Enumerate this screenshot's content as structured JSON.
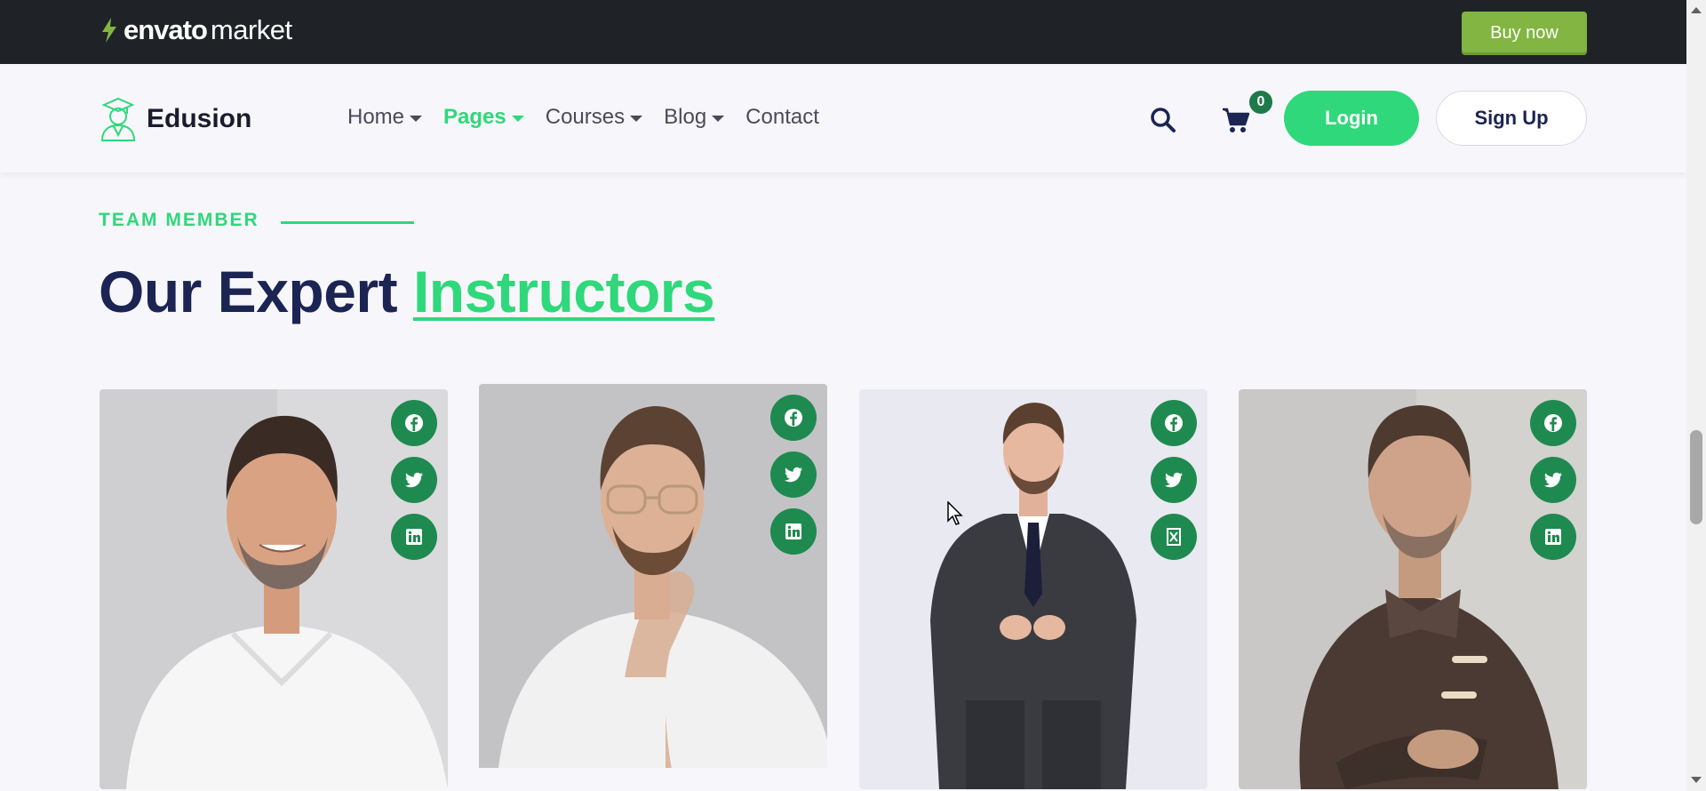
{
  "envato": {
    "logo_brand": "envato",
    "logo_product": "market",
    "buy_now_label": "Buy now",
    "brand_color": "#82b541"
  },
  "header": {
    "brand_name": "Edusion",
    "nav": [
      {
        "label": "Home",
        "dropdown": true,
        "active": false
      },
      {
        "label": "Pages",
        "dropdown": true,
        "active": true
      },
      {
        "label": "Courses",
        "dropdown": true,
        "active": false
      },
      {
        "label": "Blog",
        "dropdown": true,
        "active": false
      },
      {
        "label": "Contact",
        "dropdown": false,
        "active": false
      }
    ],
    "search_icon": "search-icon",
    "cart_icon": "cart-icon",
    "cart_count": "0",
    "login_label": "Login",
    "signup_label": "Sign Up"
  },
  "section": {
    "eyebrow": "TEAM MEMBER",
    "title_plain": "Our Expert",
    "title_accent": "Instructors"
  },
  "instructors": [
    {
      "social": [
        "facebook-icon",
        "twitter-icon",
        "linkedin-icon"
      ]
    },
    {
      "social": [
        "facebook-icon",
        "twitter-icon",
        "linkedin-icon"
      ]
    },
    {
      "social": [
        "facebook-icon",
        "twitter-icon",
        "x-icon"
      ]
    },
    {
      "social": [
        "facebook-icon",
        "twitter-icon",
        "linkedin-icon"
      ]
    }
  ],
  "colors": {
    "accent": "#2fd87a",
    "navy": "#1b2452",
    "social_bg": "#1e8a4f",
    "topbar": "#1f2328"
  }
}
